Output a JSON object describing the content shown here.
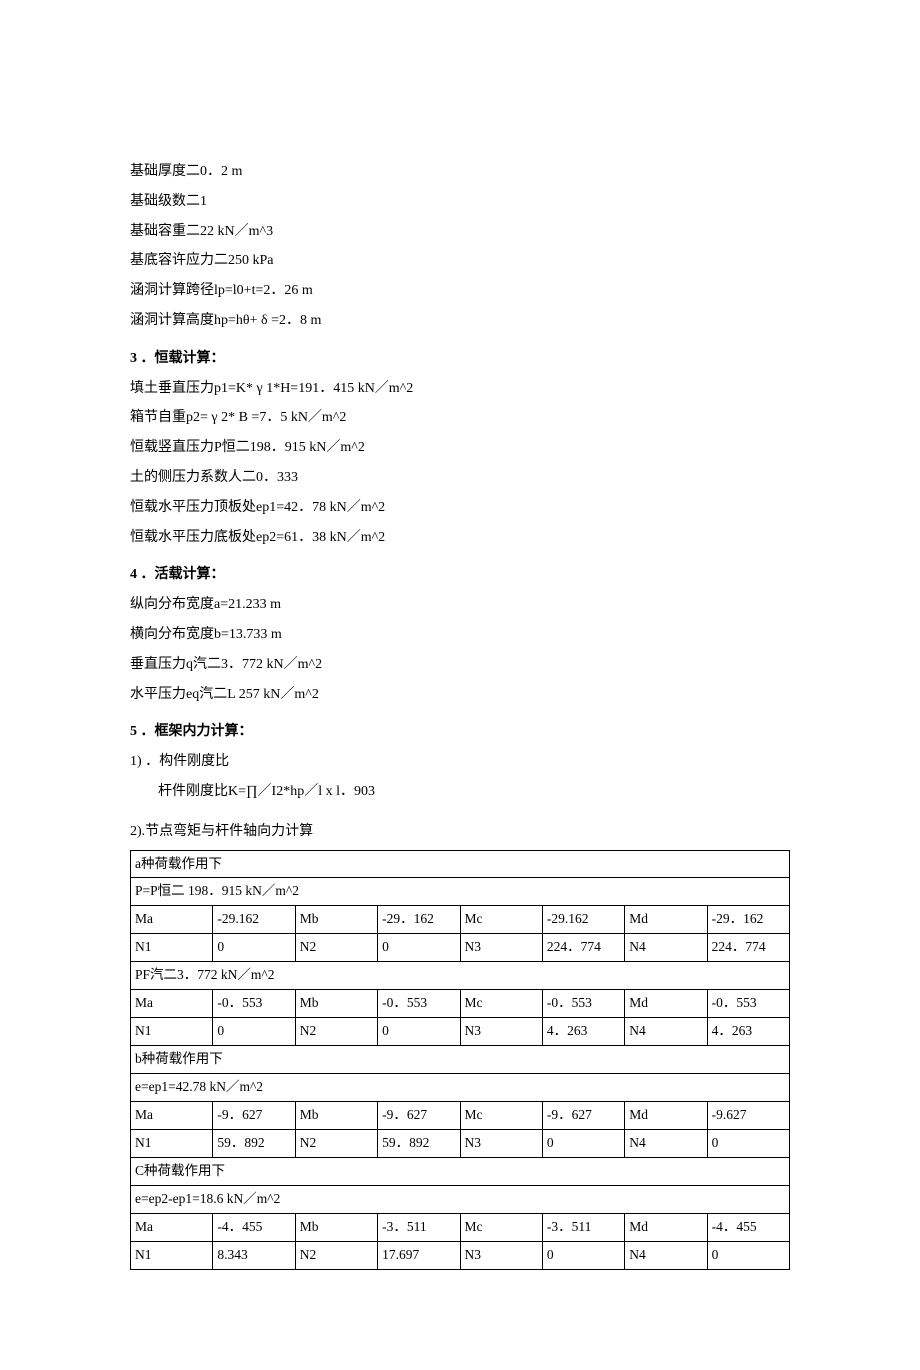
{
  "intro": {
    "l1": "基础厚度二0．2 m",
    "l2": "基础级数二1",
    "l3": "基础容重二22 kN／m^3",
    "l4": "基底容许应力二250 kPa",
    "l5": "涵洞计算跨径lp=l0+t=2．26 m",
    "l6": "涵洞计算高度hp=hθ+ δ =2．8 m"
  },
  "s3": {
    "title": "3 ．恒载计算：",
    "l1": "填土垂直压力p1=K* γ 1*H=191．415 kN／m^2",
    "l2": "箱节自重p2= γ 2* B =7．5 kN／m^2",
    "l3": "恒载竖直压力P恒二198．915 kN／m^2",
    "l4": "土的侧压力系数人二0．333",
    "l5": "恒载水平压力顶板处ep1=42．78 kN／m^2",
    "l6": "恒载水平压力底板处ep2=61．38 kN／m^2"
  },
  "s4": {
    "title": "4 ．活载计算：",
    "l1": "纵向分布宽度a=21.233 m",
    "l2": "横向分布宽度b=13.733 m",
    "l3": "垂直压力q汽二3．772 kN／m^2",
    "l4": "水平压力eq汽二L 257 kN／m^2"
  },
  "s5": {
    "title": "5 ．框架内力计算：",
    "l1": "1) ．构件刚度比",
    "l2": "杆件刚度比K=∏／I2*hp／l x l．903",
    "l3": "2).节点弯矩与杆件轴向力计算"
  },
  "tbl": {
    "a_hdr": "a种荷载作用下",
    "a_p": "P=P恒二 198．915 kN／m^2",
    "a_ma": [
      "Ma",
      "-29.162",
      "Mb",
      "-29．162",
      "Mc",
      "-29.162",
      "Md",
      "-29．162"
    ],
    "a_n1": [
      "N1",
      "0",
      "N2",
      "0",
      "N3",
      "224．774",
      "N4",
      "224．774"
    ],
    "pf_hdr": "PF汽二3．772 kN／m^2",
    "pf_ma": [
      "Ma",
      "-0．553",
      "Mb",
      "-0．553",
      "Mc",
      "-0．553",
      "Md",
      "-0．553"
    ],
    "pf_n1": [
      "N1",
      "0",
      "N2",
      "0",
      "N3",
      "4．263",
      "N4",
      "4．263"
    ],
    "b_hdr": "b种荷载作用下",
    "b_e": "e=ep1=42.78 kN／m^2",
    "b_ma": [
      "Ma",
      "-9．627",
      "Mb",
      "-9．627",
      "Mc",
      "-9．627",
      "Md",
      "-9.627"
    ],
    "b_n1": [
      "N1",
      "59．892",
      "N2",
      "59．892",
      "N3",
      "0",
      "N4",
      "0"
    ],
    "c_hdr": "C种荷载作用下",
    "c_e": "e=ep2-ep1=18.6 kN／m^2",
    "c_ma": [
      "Ma",
      "-4．455",
      "Mb",
      "-3．511",
      "Mc",
      "-3．511",
      "Md",
      "-4．455"
    ],
    "c_n1": [
      "N1",
      "8.343",
      "N2",
      "17.697",
      "N3",
      "0",
      "N4",
      "0"
    ]
  }
}
